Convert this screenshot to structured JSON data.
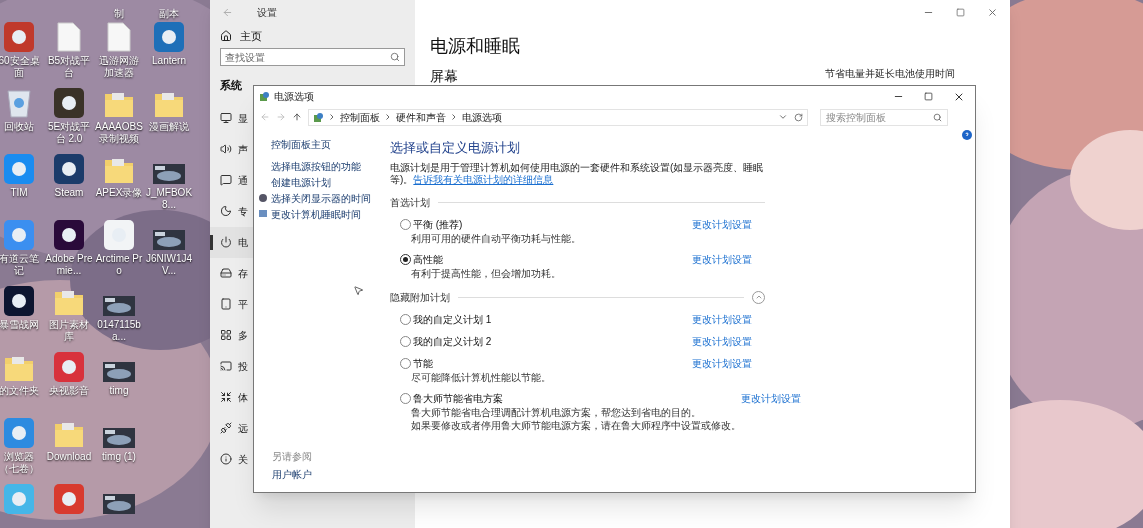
{
  "desktop": {
    "icons": [
      {
        "kind": "empty"
      },
      {
        "kind": "empty"
      },
      {
        "label": "制",
        "kind": "cut"
      },
      {
        "label": "副本",
        "kind": "cut"
      },
      {
        "label": "60安全桌面",
        "kind": "app",
        "color": "#c0392b"
      },
      {
        "label": "B5对战平台",
        "kind": "file"
      },
      {
        "label": "迅游网游加速器",
        "kind": "file"
      },
      {
        "label": "Lantern",
        "kind": "app",
        "color": "#1e6fb8"
      },
      {
        "label": "回收站",
        "kind": "recycle"
      },
      {
        "label": "5E对战平台 2.0",
        "kind": "app",
        "color": "#3a3228"
      },
      {
        "label": "AAAAOBS录制视频",
        "kind": "folder"
      },
      {
        "label": "漫画解说",
        "kind": "folder"
      },
      {
        "label": "TIM",
        "kind": "app",
        "color": "#1a8cf0"
      },
      {
        "label": "Steam",
        "kind": "app",
        "color": "#1b3b6a"
      },
      {
        "label": "APEX录像",
        "kind": "folder"
      },
      {
        "label": "J_MFBOK8...",
        "kind": "thumb"
      },
      {
        "label": "有道云笔记",
        "kind": "app",
        "color": "#3b8ff0"
      },
      {
        "label": "Adobe Premie...",
        "kind": "app",
        "color": "#2a0a3a"
      },
      {
        "label": "Arctime Pro",
        "kind": "app",
        "color": "#f2f4f6"
      },
      {
        "label": "J6NIW1J4V...",
        "kind": "thumb"
      },
      {
        "label": "暴雪战网",
        "kind": "app",
        "color": "#0d1530"
      },
      {
        "label": "图片素材库",
        "kind": "folder"
      },
      {
        "label": "0147115ba...",
        "kind": "thumb"
      },
      {
        "kind": "empty"
      },
      {
        "label": "的文件夹",
        "kind": "folder"
      },
      {
        "label": "央视影音",
        "kind": "app",
        "color": "#d8323c"
      },
      {
        "label": "timg",
        "kind": "thumb"
      },
      {
        "kind": "empty"
      },
      {
        "label": "浏览器（七卷）",
        "kind": "app",
        "color": "#2d8be0"
      },
      {
        "label": "Download",
        "kind": "folder"
      },
      {
        "label": "timg (1)",
        "kind": "thumb"
      },
      {
        "kind": "empty"
      },
      {
        "kind": "app",
        "color": "#45b6e8"
      },
      {
        "kind": "app",
        "color": "#d83a2e"
      },
      {
        "kind": "thumb"
      },
      {
        "kind": "empty"
      }
    ]
  },
  "settings_window": {
    "title": "设置",
    "home": "主页",
    "search_placeholder": "查找设置",
    "section": "系统",
    "nav": [
      {
        "label": "显",
        "selected": false
      },
      {
        "label": "声",
        "selected": false
      },
      {
        "label": "通",
        "selected": false
      },
      {
        "label": "专",
        "selected": false
      },
      {
        "label": "电",
        "selected": true
      },
      {
        "label": "存",
        "selected": false
      },
      {
        "label": "平",
        "selected": false
      },
      {
        "label": "多",
        "selected": false
      },
      {
        "label": "投",
        "selected": false
      },
      {
        "label": "体",
        "selected": false
      },
      {
        "label": "远",
        "selected": false
      },
      {
        "label": "关",
        "selected": false
      }
    ],
    "heading": "电源和睡眠",
    "subheading": "屏幕",
    "side_note": "节省电量并延长电池使用时间"
  },
  "power_options_window": {
    "title": "电源选项",
    "breadcrumb": [
      "控制面板",
      "硬件和声音",
      "电源选项"
    ],
    "search_placeholder": "搜索控制面板",
    "sidebar": [
      {
        "label": "控制面板主页",
        "kind": "home"
      },
      {
        "label": "选择电源按钮的功能",
        "kind": "link"
      },
      {
        "label": "创建电源计划",
        "kind": "link"
      },
      {
        "label": "选择关闭显示器的时间",
        "kind": "icon_link"
      },
      {
        "label": "更改计算机睡眠时间",
        "kind": "icon_link"
      }
    ],
    "see_also": {
      "title": "另请参阅",
      "links": [
        "用户帐户"
      ]
    },
    "heading": "选择或自定义电源计划",
    "description": "电源计划是用于管理计算机如何使用电源的一套硬件和系统设置(如显示器亮度、睡眠等)。",
    "description_link": "告诉我有关电源计划的详细信息",
    "groups": [
      {
        "title": "首选计划",
        "plans": [
          {
            "name": "平衡 (推荐)",
            "description": [
              "利用可用的硬件自动平衡功耗与性能。"
            ],
            "selected": false,
            "link": "更改计划设置"
          },
          {
            "name": "高性能",
            "description": [
              "有利于提高性能，但会增加功耗。"
            ],
            "selected": true,
            "link": "更改计划设置"
          }
        ]
      },
      {
        "title": "隐藏附加计划",
        "plans": [
          {
            "name": "我的自定义计划 1",
            "selected": false,
            "link": "更改计划设置"
          },
          {
            "name": "我的自定义计划 2",
            "selected": false,
            "link": "更改计划设置"
          },
          {
            "name": "节能",
            "description": [
              "尽可能降低计算机性能以节能。"
            ],
            "selected": false,
            "link": "更改计划设置"
          },
          {
            "name": "鲁大师节能省电方案",
            "description": [
              "鲁大师节能省电合理调配计算机电源方案，帮您达到省电的目的。",
              "如果要修改或者停用鲁大师节能电源方案，请在鲁大师程序中设置或修改。"
            ],
            "selected": false,
            "link": "更改计划设置"
          }
        ]
      }
    ]
  }
}
